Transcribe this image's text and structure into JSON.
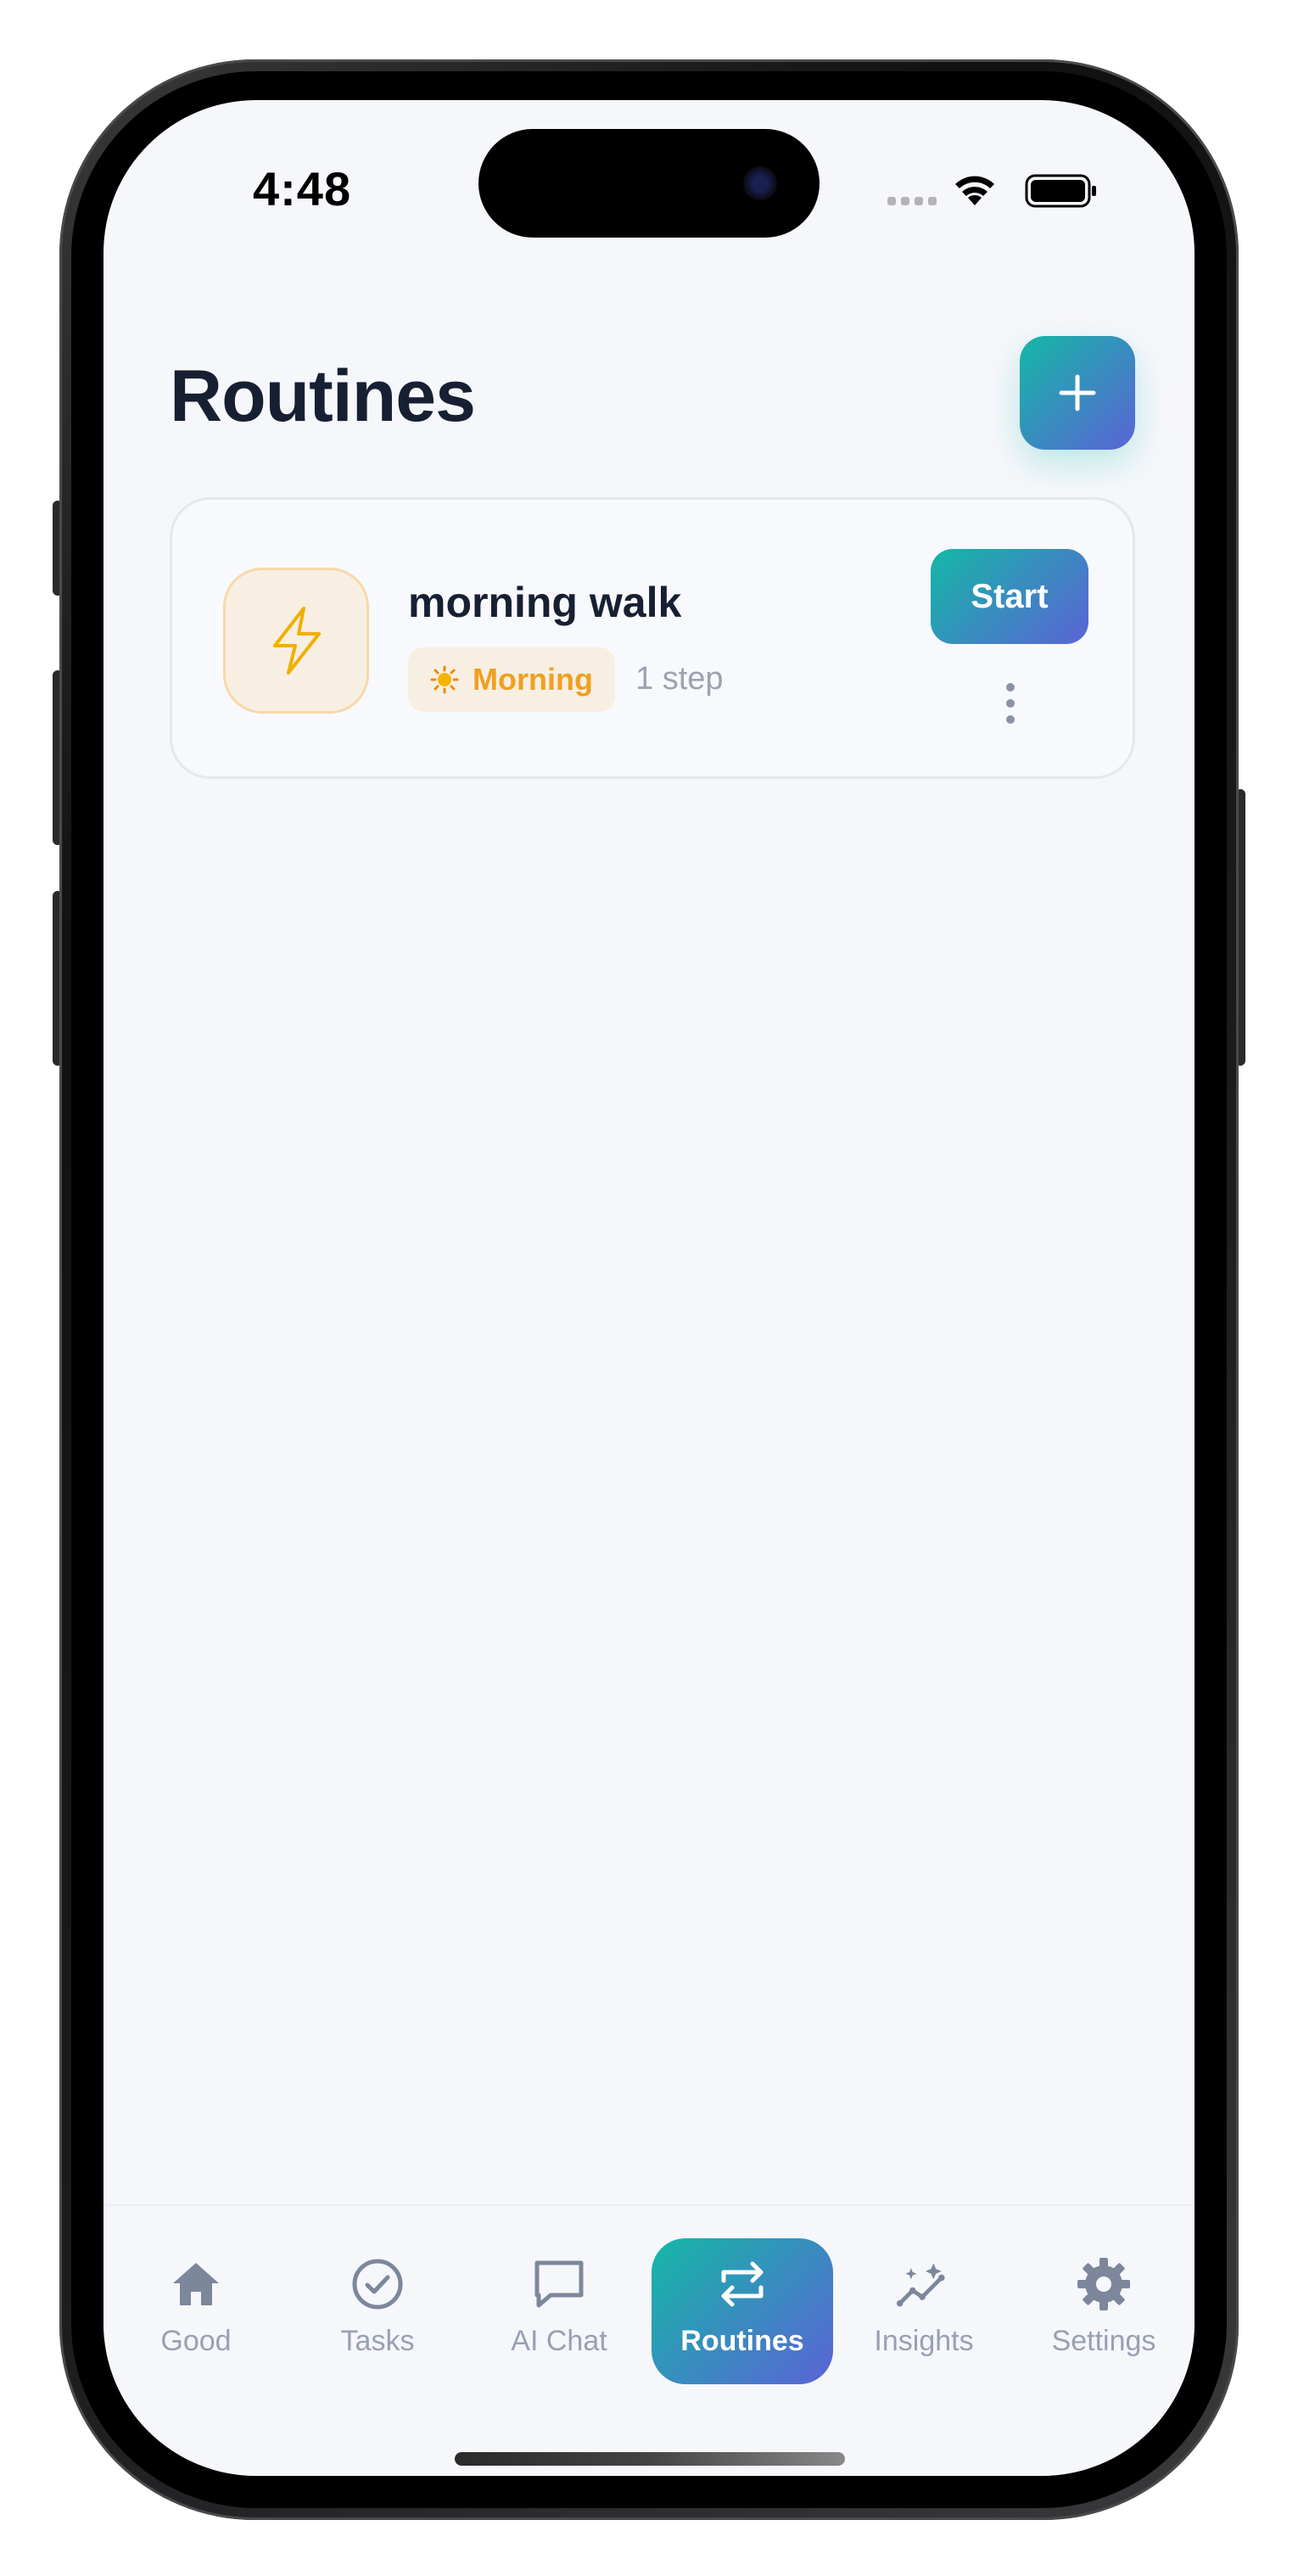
{
  "status_bar": {
    "time": "4:48"
  },
  "header": {
    "title": "Routines",
    "add_icon": "plus-icon"
  },
  "routines": [
    {
      "name": "morning walk",
      "icon": "lightning-icon",
      "time_of_day": "Morning",
      "time_icon": "sun-icon",
      "steps": "1 step",
      "start_label": "Start"
    }
  ],
  "tabbar": {
    "items": [
      {
        "label": "Good",
        "icon": "home-icon",
        "active": false
      },
      {
        "label": "Tasks",
        "icon": "check-circle-icon",
        "active": false
      },
      {
        "label": "AI Chat",
        "icon": "chat-bubble-icon",
        "active": false
      },
      {
        "label": "Routines",
        "icon": "repeat-icon",
        "active": true
      },
      {
        "label": "Insights",
        "icon": "sparkle-chart-icon",
        "active": false
      },
      {
        "label": "Settings",
        "icon": "gear-icon",
        "active": false
      }
    ]
  },
  "colors": {
    "accent_start": "#14b8a6",
    "accent_end": "#5b63d6",
    "title": "#172033",
    "muted": "#98a1b2",
    "morning": "#f0a020"
  }
}
